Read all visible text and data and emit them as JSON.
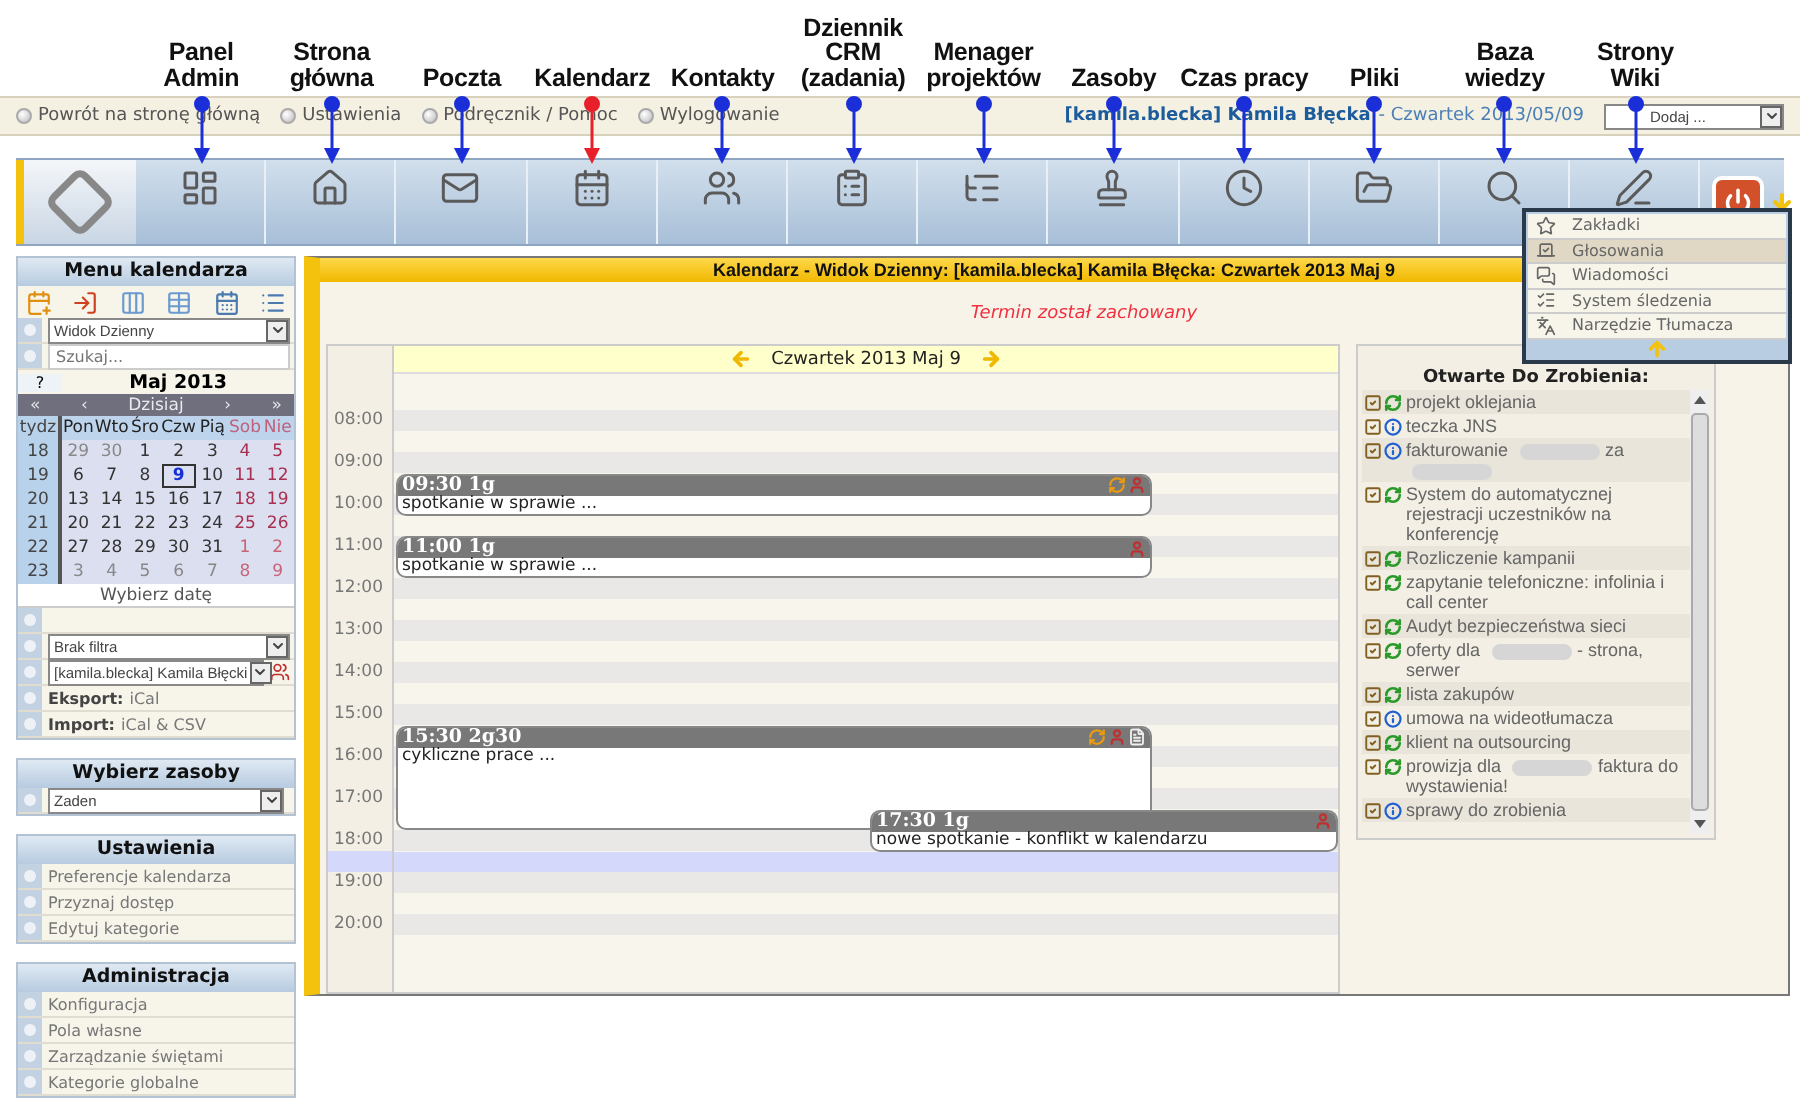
{
  "modules": [
    {
      "label": "Panel Admin",
      "kind": "admin",
      "highlighted": false
    },
    {
      "label": "Strona główna",
      "kind": "home",
      "highlighted": false
    },
    {
      "label": "Poczta",
      "kind": "mail",
      "highlighted": false
    },
    {
      "label": "Kalendarz",
      "kind": "calendar",
      "highlighted": true
    },
    {
      "label": "Kontakty",
      "kind": "contacts",
      "highlighted": false
    },
    {
      "label": "Dziennik CRM (zadania)",
      "kind": "crm",
      "highlighted": false
    },
    {
      "label": "Menager projektów",
      "kind": "projects",
      "highlighted": false
    },
    {
      "label": "Zasoby",
      "kind": "resources",
      "highlighted": false
    },
    {
      "label": "Czas pracy",
      "kind": "time",
      "highlighted": false
    },
    {
      "label": "Pliki",
      "kind": "files",
      "highlighted": false
    },
    {
      "label": "Baza wiedzy",
      "kind": "knowledge",
      "highlighted": false
    },
    {
      "label": "Strony Wiki",
      "kind": "wiki",
      "highlighted": false
    }
  ],
  "top_links": [
    "Powrót na stronę główną",
    "Ustawienia",
    "Podręcznik / Pomoc",
    "Wylogowanie"
  ],
  "user": {
    "name": "[kamila.blecka] Kamila Błęcka",
    "date": "- Czwartek 2013/05/09"
  },
  "add_select": {
    "value": "Dodaj ..."
  },
  "more_menu": {
    "items": [
      {
        "label": "Zakładki",
        "kind": "star",
        "selected": false
      },
      {
        "label": "Głosowania",
        "kind": "vote",
        "selected": true
      },
      {
        "label": "Wiadomości",
        "kind": "messages",
        "selected": false
      },
      {
        "label": "System śledzenia",
        "kind": "tracker",
        "selected": false
      },
      {
        "label": "Narzędzie Tłumacza",
        "kind": "translate",
        "selected": false
      }
    ]
  },
  "sidebar": {
    "title": "Menu kalendarza",
    "view_select": "Widok Dzienny",
    "search_placeholder": "Szukaj...",
    "mini_calendar": {
      "help": "?",
      "month": "Maj 2013",
      "nav": [
        "«",
        "‹",
        "Dzisiaj",
        "›",
        "»"
      ],
      "headers": [
        "tydz",
        "Pon",
        "Wto",
        "Śro",
        "Czw",
        "Pią",
        "Sob",
        "Nie"
      ],
      "weeks": [
        {
          "week": "18",
          "days": [
            {
              "label": "29",
              "muted": true,
              "selected": false
            },
            {
              "label": "30",
              "muted": true,
              "selected": false
            },
            {
              "label": "1",
              "muted": false,
              "selected": false
            },
            {
              "label": "2",
              "muted": false,
              "selected": false
            },
            {
              "label": "3",
              "muted": false,
              "selected": false
            },
            {
              "label": "4",
              "muted": false,
              "selected": false
            },
            {
              "label": "5",
              "muted": false,
              "selected": false
            }
          ]
        },
        {
          "week": "19",
          "days": [
            {
              "label": "6",
              "muted": false,
              "selected": false
            },
            {
              "label": "7",
              "muted": false,
              "selected": false
            },
            {
              "label": "8",
              "muted": false,
              "selected": false
            },
            {
              "label": "9",
              "muted": false,
              "selected": true
            },
            {
              "label": "10",
              "muted": false,
              "selected": false
            },
            {
              "label": "11",
              "muted": false,
              "selected": false
            },
            {
              "label": "12",
              "muted": false,
              "selected": false
            }
          ]
        },
        {
          "week": "20",
          "days": [
            {
              "label": "13",
              "muted": false,
              "selected": false
            },
            {
              "label": "14",
              "muted": false,
              "selected": false
            },
            {
              "label": "15",
              "muted": false,
              "selected": false
            },
            {
              "label": "16",
              "muted": false,
              "selected": false
            },
            {
              "label": "17",
              "muted": false,
              "selected": false
            },
            {
              "label": "18",
              "muted": false,
              "selected": false
            },
            {
              "label": "19",
              "muted": false,
              "selected": false
            }
          ]
        },
        {
          "week": "21",
          "days": [
            {
              "label": "20",
              "muted": false,
              "selected": false
            },
            {
              "label": "21",
              "muted": false,
              "selected": false
            },
            {
              "label": "22",
              "muted": false,
              "selected": false
            },
            {
              "label": "23",
              "muted": false,
              "selected": false
            },
            {
              "label": "24",
              "muted": false,
              "selected": false
            },
            {
              "label": "25",
              "muted": false,
              "selected": false
            },
            {
              "label": "26",
              "muted": false,
              "selected": false
            }
          ]
        },
        {
          "week": "22",
          "days": [
            {
              "label": "27",
              "muted": false,
              "selected": false
            },
            {
              "label": "28",
              "muted": false,
              "selected": false
            },
            {
              "label": "29",
              "muted": false,
              "selected": false
            },
            {
              "label": "30",
              "muted": false,
              "selected": false
            },
            {
              "label": "31",
              "muted": false,
              "selected": false
            },
            {
              "label": "1",
              "muted": true,
              "selected": false
            },
            {
              "label": "2",
              "muted": true,
              "selected": false
            }
          ]
        },
        {
          "week": "23",
          "days": [
            {
              "label": "3",
              "muted": true,
              "selected": false
            },
            {
              "label": "4",
              "muted": true,
              "selected": false
            },
            {
              "label": "5",
              "muted": true,
              "selected": false
            },
            {
              "label": "6",
              "muted": true,
              "selected": false
            },
            {
              "label": "7",
              "muted": true,
              "selected": false
            },
            {
              "label": "8",
              "muted": true,
              "selected": false
            },
            {
              "label": "9",
              "muted": true,
              "selected": false
            }
          ]
        }
      ],
      "footer": "Wybierz datę"
    },
    "filter_select": "Brak filtra",
    "user_select": "[kamila.blecka] Kamila Błęcki",
    "export": {
      "label": "Eksport:",
      "link": "iCal"
    },
    "import": {
      "label": "Import:",
      "link": "iCal & CSV"
    }
  },
  "resources": {
    "title": "Wybierz zasoby",
    "select": "Zaden"
  },
  "settings": {
    "title": "Ustawienia",
    "items": [
      "Preferencje kalendarza",
      "Przyznaj dostęp",
      "Edytuj kategorie"
    ]
  },
  "administration": {
    "title": "Administracja",
    "items": [
      "Konfiguracja",
      "Pola własne",
      "Zarządzanie świętami",
      "Kategorie globalne"
    ]
  },
  "main": {
    "title": "Kalendarz - Widok Dzienny: [kamila.blecka] Kamila Błęcka: Czwartek 2013 Maj 9",
    "message": "Termin został zachowany",
    "day_header": "Czwartek 2013 Maj 9",
    "hours": [
      {
        "label": "08:00",
        "second_half_selected": false
      },
      {
        "label": "09:00",
        "second_half_selected": false
      },
      {
        "label": "10:00",
        "second_half_selected": false
      },
      {
        "label": "11:00",
        "second_half_selected": false
      },
      {
        "label": "12:00",
        "second_half_selected": false
      },
      {
        "label": "13:00",
        "second_half_selected": false
      },
      {
        "label": "14:00",
        "second_half_selected": false
      },
      {
        "label": "15:00",
        "second_half_selected": false
      },
      {
        "label": "16:00",
        "second_half_selected": false
      },
      {
        "label": "17:00",
        "second_half_selected": false
      },
      {
        "label": "18:00",
        "second_half_selected": true
      },
      {
        "label": "19:00",
        "second_half_selected": false
      },
      {
        "label": "20:00",
        "second_half_selected": false
      }
    ],
    "events": [
      {
        "time": "09:30 1g",
        "title": "spotkanie w sprawie ...",
        "recurring": true,
        "has_note": false
      },
      {
        "time": "11:00 1g",
        "title": "spotkanie w sprawie ...",
        "recurring": false,
        "has_note": false
      },
      {
        "time": "15:30 2g30",
        "title": "cykliczne prace ...",
        "recurring": true,
        "has_note": true
      },
      {
        "time": "17:30 1g",
        "title": "nowe spotkanie - konflikt w kalendarzu",
        "recurring": false,
        "has_note": false
      }
    ]
  },
  "todo": {
    "title": "Otwarte Do Zrobienia:",
    "items": [
      {
        "kind": "done",
        "parts": [
          {
            "kind": "text",
            "text": "projekt oklejania"
          }
        ]
      },
      {
        "kind": "info",
        "parts": [
          {
            "kind": "text",
            "text": "teczka JNS"
          }
        ]
      },
      {
        "kind": "info",
        "parts": [
          {
            "kind": "text",
            "text": "fakturowanie"
          },
          {
            "kind": "redacted"
          },
          {
            "kind": "text",
            "text": "za"
          },
          {
            "kind": "redacted"
          }
        ]
      },
      {
        "kind": "done",
        "parts": [
          {
            "kind": "text",
            "text": "System do automatycznej rejestracji uczestników na konferencję"
          }
        ]
      },
      {
        "kind": "done",
        "parts": [
          {
            "kind": "text",
            "text": "Rozliczenie kampanii"
          }
        ]
      },
      {
        "kind": "done",
        "parts": [
          {
            "kind": "text",
            "text": "zapytanie telefoniczne: infolinia i call center"
          }
        ]
      },
      {
        "kind": "done",
        "parts": [
          {
            "kind": "text",
            "text": "Audyt bezpieczeństwa sieci"
          }
        ]
      },
      {
        "kind": "done",
        "parts": [
          {
            "kind": "text",
            "text": "oferty dla"
          },
          {
            "kind": "redacted"
          },
          {
            "kind": "text",
            "text": "- strona, serwer"
          }
        ]
      },
      {
        "kind": "done",
        "parts": [
          {
            "kind": "text",
            "text": "lista zakupów"
          }
        ]
      },
      {
        "kind": "info",
        "parts": [
          {
            "kind": "text",
            "text": "umowa na wideotłumacza"
          }
        ]
      },
      {
        "kind": "done",
        "parts": [
          {
            "kind": "text",
            "text": "klient na outsourcing"
          }
        ]
      },
      {
        "kind": "done",
        "parts": [
          {
            "kind": "text",
            "text": "prowizja dla"
          },
          {
            "kind": "redacted"
          },
          {
            "kind": "text",
            "text": "faktura do wystawienia!"
          }
        ]
      },
      {
        "kind": "info",
        "parts": [
          {
            "kind": "text",
            "text": "sprawy do zrobienia"
          }
        ]
      }
    ]
  }
}
